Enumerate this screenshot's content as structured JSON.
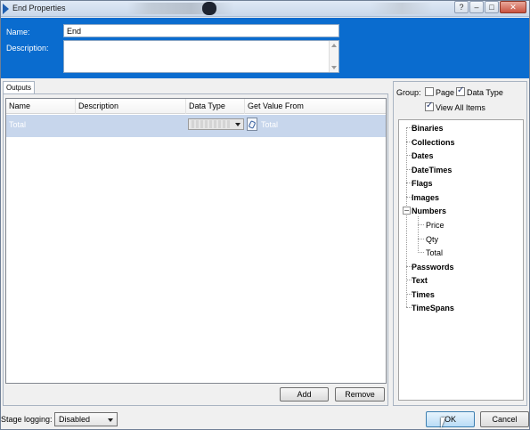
{
  "window": {
    "title": "End Properties"
  },
  "header": {
    "name_label": "Name:",
    "name_value": "End",
    "description_label": "Description:",
    "description_value": ""
  },
  "outputs": {
    "tab_label": "Outputs",
    "columns": [
      "Name",
      "Description",
      "Data Type",
      "Get Value From"
    ],
    "rows": [
      {
        "name": "Total",
        "description": "",
        "data_type": "",
        "get_value_from": "Total"
      }
    ],
    "add_label": "Add",
    "remove_label": "Remove"
  },
  "data_panel": {
    "group_label": "Group:",
    "page_label": "Page",
    "page_checked": false,
    "data_type_label": "Data Type",
    "data_type_checked": true,
    "view_all_label": "View All Items",
    "view_all_checked": true,
    "tree": [
      {
        "label": "Binaries",
        "bold": true
      },
      {
        "label": "Collections",
        "bold": true
      },
      {
        "label": "Dates",
        "bold": true
      },
      {
        "label": "DateTimes",
        "bold": true
      },
      {
        "label": "Flags",
        "bold": true
      },
      {
        "label": "Images",
        "bold": true
      },
      {
        "label": "Numbers",
        "bold": true,
        "expanded": true,
        "children": [
          "Price",
          "Qty",
          "Total"
        ]
      },
      {
        "label": "Passwords",
        "bold": true
      },
      {
        "label": "Text",
        "bold": true
      },
      {
        "label": "Times",
        "bold": true
      },
      {
        "label": "TimeSpans",
        "bold": true
      }
    ]
  },
  "footer": {
    "stage_logging_label": "Stage logging:",
    "stage_logging_value": "Disabled",
    "ok_label": "OK",
    "cancel_label": "Cancel"
  },
  "title_buttons": {
    "help": "?",
    "minimize": "–",
    "maximize": "□",
    "close": "✕"
  },
  "colors": {
    "header_blue": "#0a6ccf",
    "selected_row": "#c7d6ec"
  }
}
